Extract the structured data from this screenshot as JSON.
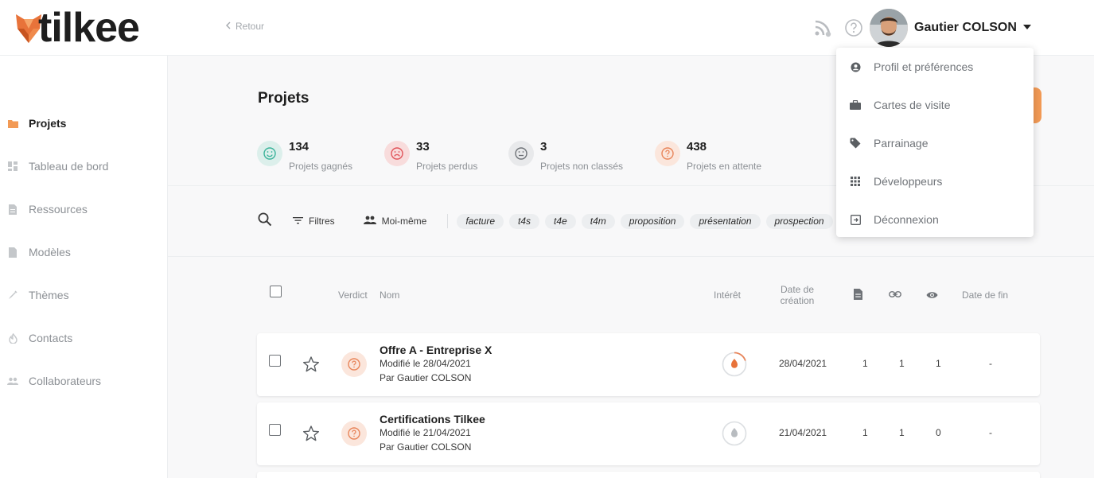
{
  "header": {
    "brand": "tilkee",
    "back_label": "Retour",
    "user_name": "Gautier COLSON",
    "icons": [
      "rss-icon",
      "help-icon",
      "avatar",
      "caret-down-icon"
    ]
  },
  "sidebar": {
    "items": [
      {
        "label": "Projets",
        "icon": "folder-icon",
        "active": true
      },
      {
        "label": "Tableau de bord",
        "icon": "dashboard-icon",
        "active": false
      },
      {
        "label": "Ressources",
        "icon": "document-icon",
        "active": false
      },
      {
        "label": "Modèles",
        "icon": "template-icon",
        "active": false
      },
      {
        "label": "Thèmes",
        "icon": "brush-icon",
        "active": false
      },
      {
        "label": "Contacts",
        "icon": "contact-icon",
        "active": false
      },
      {
        "label": "Collaborateurs",
        "icon": "people-icon",
        "active": false
      }
    ]
  },
  "main": {
    "title": "Projets",
    "stats": [
      {
        "value": "134",
        "label": "Projets gagnés",
        "icon": "smile-icon",
        "color": "#3bb39a",
        "bg": "#dcefeb"
      },
      {
        "value": "33",
        "label": "Projets perdus",
        "icon": "sad-icon",
        "color": "#e0545a",
        "bg": "#f8dcdc"
      },
      {
        "value": "3",
        "label": "Projets non classés",
        "icon": "neutral-icon",
        "color": "#6f7378",
        "bg": "#e8e9eb"
      },
      {
        "value": "438",
        "label": "Projets en attente",
        "icon": "question-icon",
        "color": "#e8855a",
        "bg": "#fbe6dc"
      }
    ],
    "filters": {
      "filter_label": "Filtres",
      "owner_label": "Moi-même",
      "tags": [
        "facture",
        "t4s",
        "t4e",
        "t4m",
        "proposition",
        "présentation",
        "prospection"
      ]
    },
    "table": {
      "columns": {
        "verdict": "Verdict",
        "name": "Nom",
        "interest": "Intérêt",
        "created_1": "Date de",
        "created_2": "création",
        "end": "Date de fin"
      },
      "rows": [
        {
          "name": "Offre A - Entreprise X",
          "modified": "Modifié le 28/04/2021",
          "author": "Par Gautier COLSON",
          "created": "28/04/2021",
          "docs": "1",
          "links": "1",
          "views": "1",
          "end": "-",
          "interest_level": 0.2,
          "interest_color": "#e8855a"
        },
        {
          "name": "Certifications Tilkee",
          "modified": "Modifié le 21/04/2021",
          "author": "Par Gautier COLSON",
          "created": "21/04/2021",
          "docs": "1",
          "links": "1",
          "views": "0",
          "end": "-",
          "interest_level": 0,
          "interest_color": "#b8bcc0"
        }
      ]
    }
  },
  "user_menu": {
    "items": [
      {
        "label": "Profil et préférences",
        "icon": "account-icon"
      },
      {
        "label": "Cartes de visite",
        "icon": "briefcase-icon"
      },
      {
        "label": "Parrainage",
        "icon": "tag-icon"
      },
      {
        "label": "Développeurs",
        "icon": "apps-grid-icon"
      },
      {
        "label": "Déconnexion",
        "icon": "logout-icon"
      }
    ]
  },
  "colors": {
    "brand_orange": "#f29a55",
    "accent": "#e8855a"
  }
}
